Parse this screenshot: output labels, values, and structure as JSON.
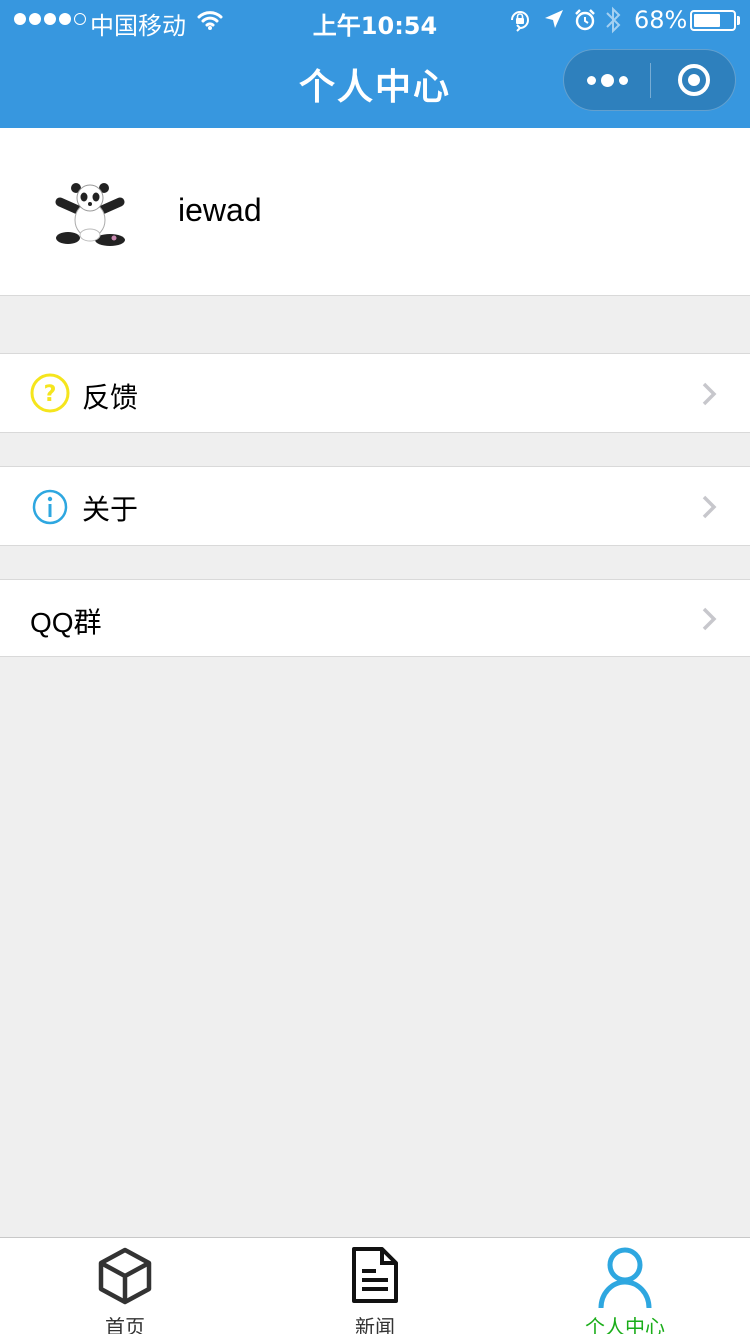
{
  "status_bar": {
    "carrier": "中国移动",
    "time": "上午10:54",
    "battery_percent": "68%",
    "battery_level": 0.68,
    "icons": [
      "wifi-icon",
      "orientation-lock-icon",
      "location-icon",
      "alarm-icon",
      "bluetooth-icon",
      "battery-icon"
    ]
  },
  "nav": {
    "title": "个人中心",
    "capsule_icons": [
      "more-icon",
      "close-target-icon"
    ]
  },
  "profile": {
    "username": "iewad",
    "avatar_icon": "panda-avatar-icon"
  },
  "menu": [
    {
      "label": "反馈",
      "icon": "help-circle-icon",
      "icon_color": "#f5e51d"
    },
    {
      "label": "关于",
      "icon": "info-circle-icon",
      "icon_color": "#2ea7e0"
    },
    {
      "label": "QQ群",
      "icon": ""
    }
  ],
  "tabbar": {
    "items": [
      {
        "label": "首页",
        "icon": "cube-icon"
      },
      {
        "label": "新闻",
        "icon": "document-icon"
      },
      {
        "label": "个人中心",
        "icon": "user-icon",
        "active": true
      }
    ],
    "active_color": "#1aad19",
    "active_icon_color": "#2ea7e0"
  },
  "colors": {
    "nav_background": "#3797df",
    "page_background": "#efefef"
  }
}
